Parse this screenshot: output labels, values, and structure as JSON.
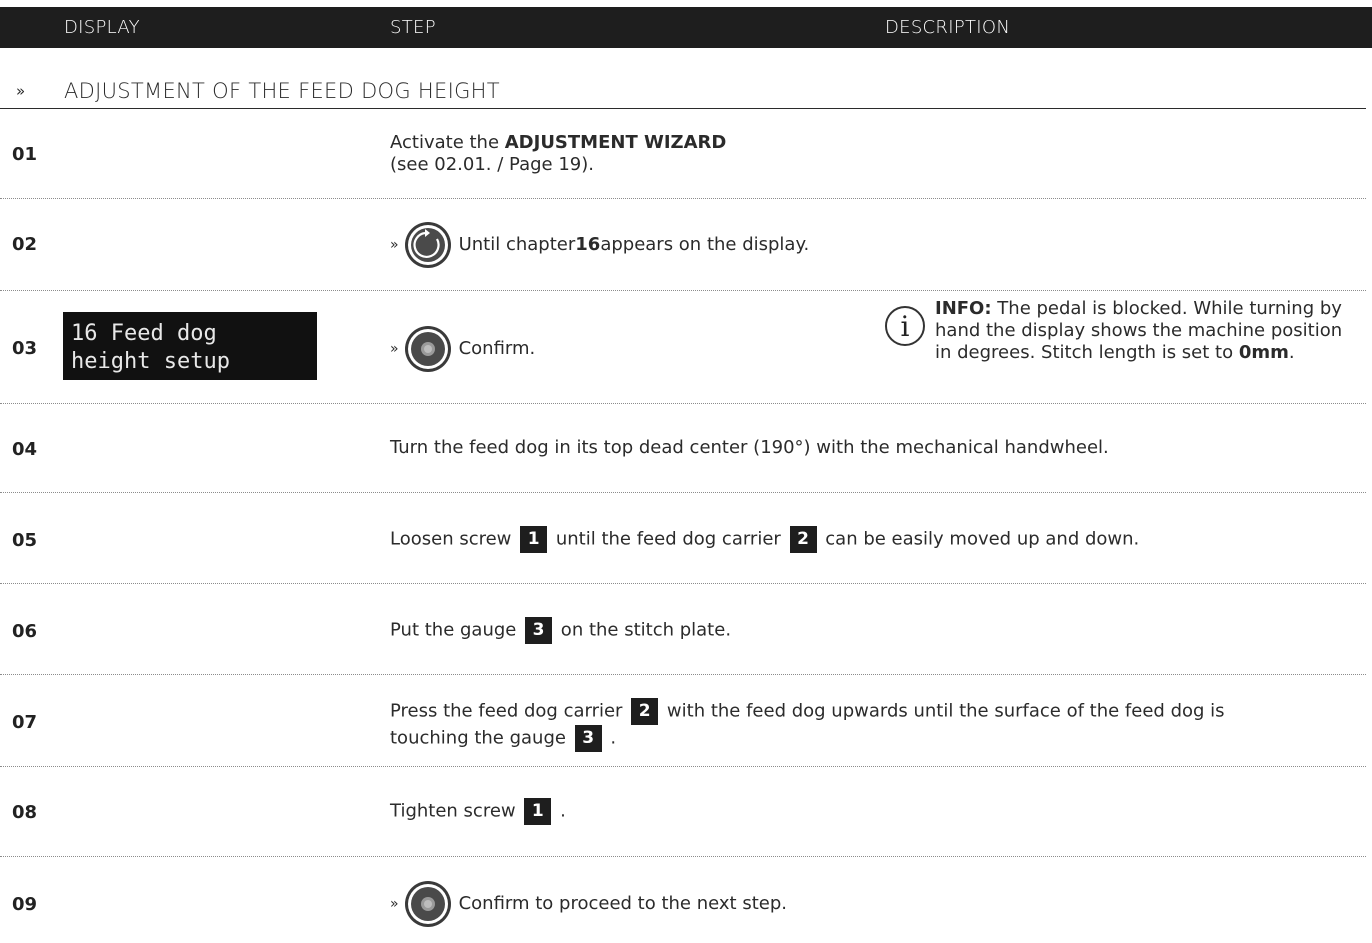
{
  "header": {
    "display": "DISPLAY",
    "step": "STEP",
    "description": "DESCRIPTION"
  },
  "section": {
    "marker": "»",
    "title": "ADJUSTMENT OF THE FEED DOG HEIGHT"
  },
  "display_screen": {
    "line1": "16 Feed dog",
    "line2": "height setup"
  },
  "rows": [
    {
      "num": "01",
      "text_a": "Activate the ",
      "bold": "ADJUSTMENT WIZARD",
      "text_b": "(see 02.01. / Page 19)."
    },
    {
      "num": "02",
      "marker": "»",
      "knob": "rotary-knob-icon",
      "text_a": "Until chapter ",
      "bold": "16",
      "text_b": " appears on the display."
    },
    {
      "num": "03",
      "marker": "»",
      "knob": "push-knob-icon",
      "text": "Confirm."
    },
    {
      "num": "04",
      "text": "Turn the feed dog in its top dead center (190°) with the mechanical handwheel."
    },
    {
      "num": "05",
      "text_a": "Loosen screw ",
      "badge1": "1",
      "text_b": " until the feed dog carrier ",
      "badge2": "2",
      "text_c": " can be easily moved up and down."
    },
    {
      "num": "06",
      "text_a": "Put the gauge ",
      "badge1": "3",
      "text_b": " on the stitch plate."
    },
    {
      "num": "07",
      "text_a": "Press the feed dog carrier ",
      "badge1": "2",
      "text_b": " with the feed dog upwards until the surface of the feed dog is",
      "text_c": "touching the gauge ",
      "badge2": "3",
      "text_d": " ."
    },
    {
      "num": "08",
      "text_a": "Tighten screw ",
      "badge1": "1",
      "text_b": " ."
    },
    {
      "num": "09",
      "marker": "»",
      "knob": "push-knob-icon",
      "text": "Confirm to proceed to the next step."
    }
  ],
  "info": {
    "icon": "info-icon",
    "label": "INFO:",
    "text_a": " The pedal is blocked. While turning by hand the display shows the machine position in degrees. Stitch length is set to ",
    "bold": "0mm",
    "text_b": "."
  }
}
